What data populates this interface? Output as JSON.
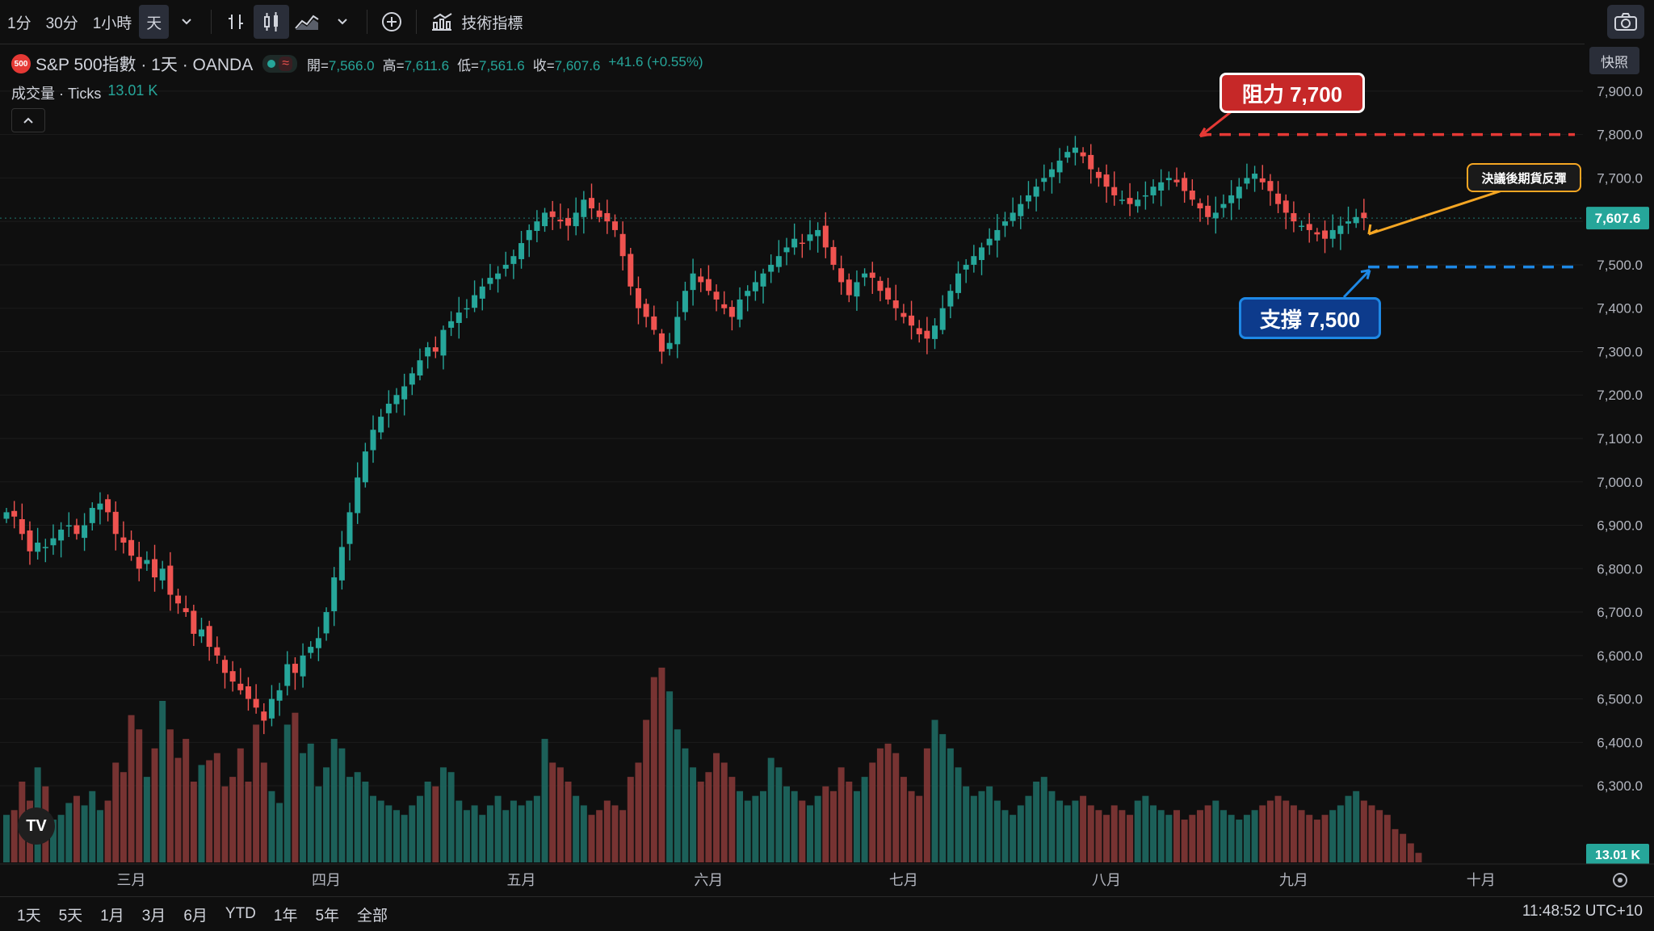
{
  "toolbar": {
    "intervals": [
      "1分",
      "30分",
      "1小時",
      "天"
    ],
    "indicators_label": "技術指標"
  },
  "legend": {
    "badge": "500",
    "title": "S&P 500指數 · 1天 · OANDA",
    "open_label": "開=",
    "open": "7,566.0",
    "high_label": "高=",
    "high": "7,611.6",
    "low_label": "低=",
    "low": "7,561.6",
    "close_label": "收=",
    "close": "7,607.6",
    "change": "+41.6 (+0.55%)"
  },
  "volume_legend": {
    "label": "成交量 · Ticks",
    "value": "13.01 K"
  },
  "snapshot_label": "快照",
  "price_tag": "7,607.6",
  "volume_tag": "13.01 K",
  "annotations": {
    "resistance": "阻力 7,700",
    "support": "支撐 7,500",
    "rebound": "決議後期貨反彈"
  },
  "bottom": {
    "ranges": [
      "1天",
      "5天",
      "1月",
      "3月",
      "6月",
      "YTD",
      "1年",
      "5年",
      "全部"
    ],
    "clock": "11:48:52 UTC+10"
  },
  "colors": {
    "up": "#26a69a",
    "down": "#ef5350",
    "up_vol": "#1f6f66",
    "down_vol": "#8a3a38"
  },
  "chart_data": {
    "type": "candlestick",
    "y_ticks": [
      6300,
      6400,
      6500,
      6600,
      6700,
      6800,
      6900,
      7000,
      7100,
      7200,
      7300,
      7400,
      7500,
      7600,
      7700,
      7800,
      7900
    ],
    "ylim": [
      6250,
      7950
    ],
    "x_labels": [
      {
        "label": "三月",
        "index": 16
      },
      {
        "label": "四月",
        "index": 41
      },
      {
        "label": "五月",
        "index": 66
      },
      {
        "label": "六月",
        "index": 90
      },
      {
        "label": "七月",
        "index": 115
      },
      {
        "label": "八月",
        "index": 141
      },
      {
        "label": "九月",
        "index": 165
      },
      {
        "label": "十月",
        "index": 189
      }
    ],
    "resistance": 7800,
    "support": 7495,
    "closes": [
      6930,
      6920,
      6880,
      6840,
      6860,
      6850,
      6870,
      6890,
      6900,
      6880,
      6900,
      6940,
      6950,
      6930,
      6880,
      6860,
      6830,
      6800,
      6820,
      6780,
      6800,
      6740,
      6720,
      6700,
      6650,
      6660,
      6620,
      6600,
      6560,
      6540,
      6520,
      6500,
      6480,
      6450,
      6500,
      6520,
      6580,
      6560,
      6600,
      6620,
      6640,
      6700,
      6780,
      6850,
      6930,
      7010,
      7070,
      7120,
      7150,
      7180,
      7200,
      7220,
      7250,
      7280,
      7310,
      7300,
      7350,
      7370,
      7390,
      7400,
      7430,
      7450,
      7470,
      7480,
      7500,
      7520,
      7550,
      7580,
      7600,
      7620,
      7610,
      7600,
      7590,
      7620,
      7650,
      7630,
      7610,
      7600,
      7580,
      7520,
      7450,
      7400,
      7380,
      7350,
      7300,
      7320,
      7380,
      7440,
      7480,
      7460,
      7440,
      7420,
      7400,
      7380,
      7420,
      7440,
      7460,
      7480,
      7500,
      7520,
      7540,
      7560,
      7550,
      7570,
      7580,
      7540,
      7500,
      7460,
      7430,
      7460,
      7480,
      7470,
      7440,
      7420,
      7400,
      7380,
      7360,
      7340,
      7330,
      7360,
      7400,
      7440,
      7480,
      7500,
      7520,
      7540,
      7560,
      7580,
      7600,
      7620,
      7640,
      7660,
      7680,
      7700,
      7720,
      7740,
      7760,
      7770,
      7750,
      7720,
      7700,
      7680,
      7660,
      7650,
      7640,
      7650,
      7660,
      7680,
      7690,
      7700,
      7690,
      7670,
      7650,
      7630,
      7610,
      7620,
      7640,
      7660,
      7680,
      7700,
      7710,
      7690,
      7670,
      7640,
      7620,
      7600,
      7590,
      7580,
      7570,
      7560,
      7580,
      7590,
      7600,
      7610,
      7607.6
    ],
    "volumes": [
      2.0,
      2.2,
      3.4,
      2.6,
      4.0,
      3.2,
      1.8,
      2.0,
      2.5,
      2.8,
      2.4,
      3.0,
      2.2,
      2.6,
      4.2,
      3.8,
      6.2,
      5.6,
      3.6,
      4.8,
      6.8,
      5.6,
      4.4,
      5.2,
      3.4,
      4.1,
      4.3,
      4.6,
      3.2,
      3.6,
      4.8,
      3.4,
      5.8,
      4.2,
      3.0,
      2.5,
      5.8,
      6.3,
      4.6,
      5.0,
      3.2,
      4.0,
      5.2,
      4.8,
      3.6,
      3.8,
      3.4,
      2.8,
      2.6,
      2.4,
      2.2,
      2.0,
      2.4,
      2.8,
      3.4,
      3.2,
      4.0,
      3.8,
      2.6,
      2.2,
      2.4,
      2.0,
      2.4,
      2.8,
      2.2,
      2.6,
      2.4,
      2.6,
      2.8,
      5.2,
      4.2,
      4.0,
      3.4,
      2.8,
      2.4,
      2.0,
      2.2,
      2.6,
      2.4,
      2.2,
      3.6,
      4.2,
      6.0,
      7.8,
      8.2,
      7.2,
      5.6,
      4.8,
      4.0,
      3.4,
      3.8,
      4.6,
      4.2,
      3.6,
      3.0,
      2.6,
      2.8,
      3.0,
      4.4,
      4.0,
      3.2,
      3.0,
      2.6,
      2.4,
      2.8,
      3.2,
      3.0,
      4.0,
      3.4,
      3.0,
      3.6,
      4.2,
      4.8,
      5.0,
      4.6,
      3.6,
      3.0,
      2.8,
      4.8,
      6.0,
      5.4,
      4.8,
      4.0,
      3.2,
      2.8,
      3.0,
      3.2,
      2.6,
      2.2,
      2.0,
      2.4,
      2.8,
      3.4,
      3.6,
      3.0,
      2.6,
      2.4,
      2.6,
      2.8,
      2.4,
      2.2,
      2.0,
      2.4,
      2.2,
      2.0,
      2.6,
      2.8,
      2.4,
      2.2,
      2.0,
      2.2,
      1.8,
      2.0,
      2.2,
      2.4,
      2.6,
      2.2,
      2.0,
      1.8,
      2.0,
      2.2,
      2.4,
      2.6,
      2.8,
      2.6,
      2.4,
      2.2,
      2.0,
      1.8,
      2.0,
      2.2,
      2.4,
      2.8,
      3.0,
      2.6,
      2.4,
      2.2,
      2.0,
      1.4,
      1.2,
      0.8,
      0.4
    ],
    "vol_max": 8.5
  }
}
